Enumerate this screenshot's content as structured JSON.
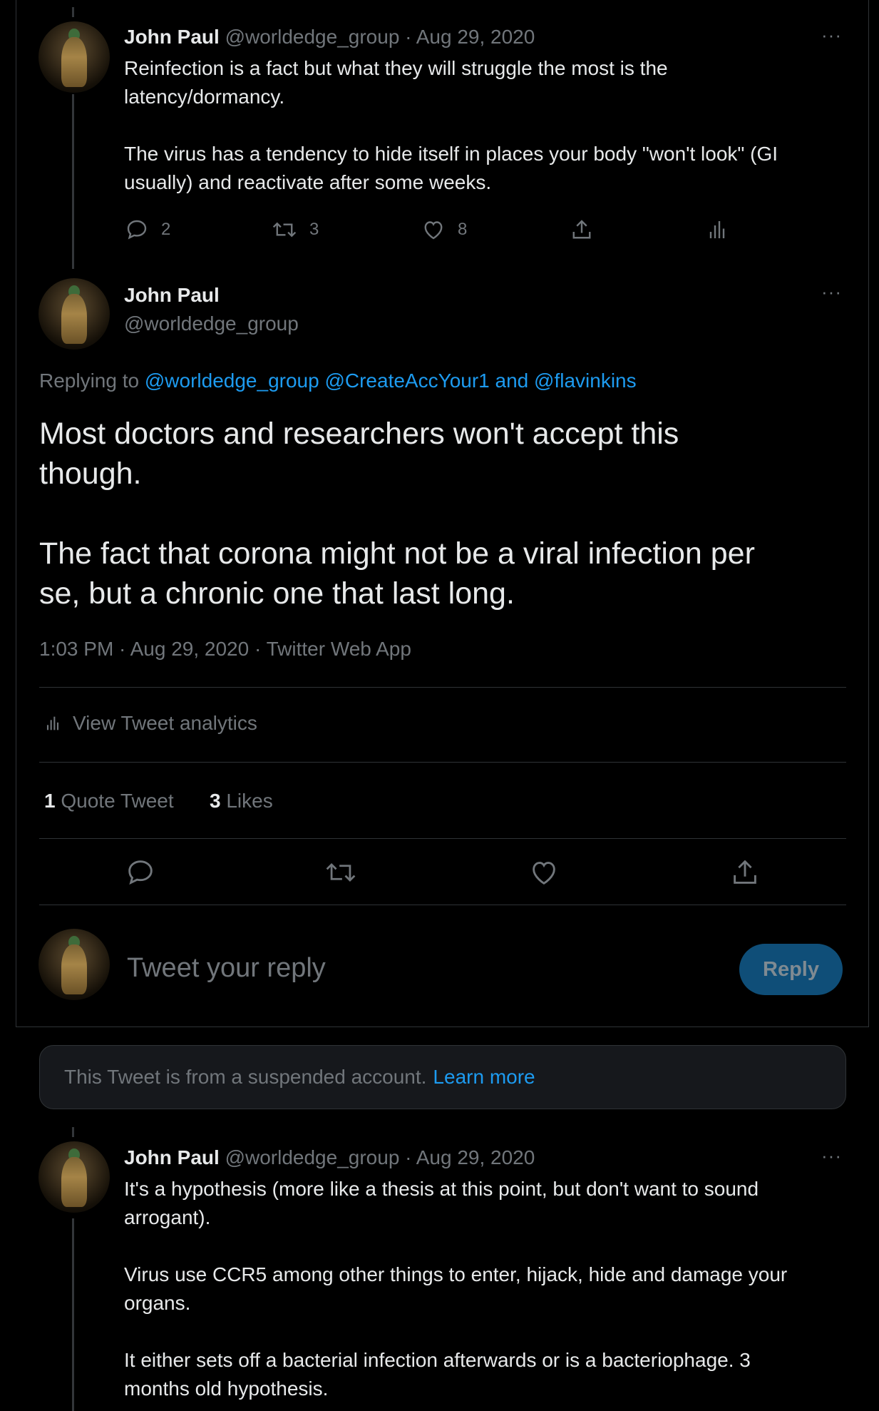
{
  "tweets": [
    {
      "name": "John Paul",
      "handle": "@worldedge_group",
      "date": "· Aug 29, 2020",
      "text_line1": "Reinfection is a fact but what they will struggle the most is the",
      "text_line2": "latency/dormancy.",
      "text_line3": "The virus has a tendency to hide itself in places your body \"won't look\" (GI",
      "text_line4": "usually) and reactivate after some weeks.",
      "replies": "2",
      "retweets": "3",
      "likes": "8"
    }
  ],
  "main": {
    "name": "John Paul",
    "handle": "@worldedge_group",
    "replying_prefix": "Replying to",
    "replying_handles": "@worldedge_group @CreateAccYour1 and @flavinkins",
    "text_line1": "Most doctors and researchers won't accept this",
    "text_line2": "though.",
    "text_line3": "The fact that corona might not be a viral infection per",
    "text_line4": "se, but a chronic one that last long.",
    "timestamp": "1:03 PM · Aug 29, 2020 · Twitter Web App",
    "analytics_label": "View Tweet analytics",
    "quote_count": "1",
    "quote_label": "Quote Tweet",
    "likes_count": "3",
    "likes_label": "Likes"
  },
  "reply_box": {
    "placeholder": "Tweet your reply",
    "button_label": "Reply"
  },
  "suspended": {
    "text": "This Tweet is from a suspended account.",
    "link": "Learn more"
  },
  "last_tweet": {
    "name": "John Paul",
    "handle": "@worldedge_group",
    "date": "· Aug 29, 2020",
    "line1": "It's a hypothesis (more like a thesis at this point, but don't want to sound",
    "line2": "arrogant).",
    "line3": "Virus use CCR5 among other things to enter, hijack, hide and damage your",
    "line4": "organs.",
    "line5": "It either sets off a bacterial infection afterwards or is a bacteriophage. 3",
    "line6": "months old hypothesis."
  },
  "more_label": "···",
  "colors": {
    "accent": "#1d9bf0",
    "muted": "#71767b",
    "background": "#000000",
    "reply_button": "#0f4e78"
  }
}
